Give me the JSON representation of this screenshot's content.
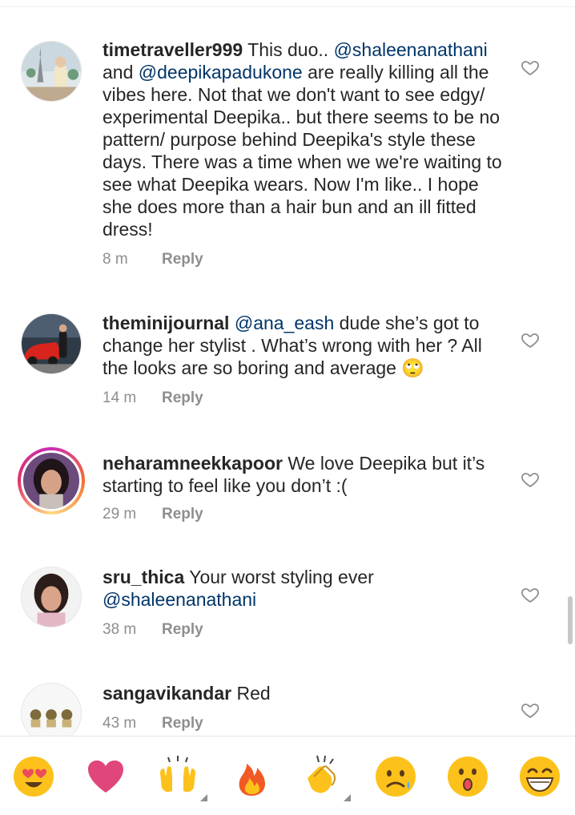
{
  "comments": [
    {
      "username": "timetraveller999",
      "parts": [
        {
          "t": " This duo.. "
        },
        {
          "t": "@shaleenanathani",
          "m": true
        },
        {
          "t": " and "
        },
        {
          "t": "@deepikapadukone",
          "m": true
        },
        {
          "t": " are really killing all the vibes here. Not that we don't want to see edgy/ experimental Deepika.. but there seems to be no pattern/ purpose behind Deepika's style these days. There was a time when we we're waiting to see what Deepika wears. Now I'm like.. I hope she does more than a hair bun and an ill fitted dress!"
        }
      ],
      "time": "8 m",
      "reply": "Reply"
    },
    {
      "username": "theminijournal",
      "parts": [
        {
          "t": " "
        },
        {
          "t": "@ana_eash",
          "m": true
        },
        {
          "t": "  dude she’s got to change her stylist . What’s wrong with her ? All the looks are so boring and average 🙄"
        }
      ],
      "time": "14 m",
      "reply": "Reply"
    },
    {
      "username": "neharamneekkapoor",
      "parts": [
        {
          "t": " We love Deepika but it’s starting to feel like you don’t :("
        }
      ],
      "time": "29 m",
      "reply": "Reply"
    },
    {
      "username": "sru_thica",
      "parts": [
        {
          "t": " Your worst styling ever "
        },
        {
          "t": "@shaleenanathani",
          "m": true
        }
      ],
      "time": "38 m",
      "reply": "Reply"
    },
    {
      "username": "sangavikandar",
      "parts": [
        {
          "t": " Red"
        }
      ],
      "time": "43 m",
      "reply": "Reply"
    }
  ],
  "emoji_bar": [
    {
      "icon": "heart-eyes-emoji",
      "glyph": "😍"
    },
    {
      "icon": "heart-emoji",
      "glyph": "❤️"
    },
    {
      "icon": "raised-hands-emoji",
      "glyph": "🙌"
    },
    {
      "icon": "fire-emoji",
      "glyph": "🔥"
    },
    {
      "icon": "clapping-hands-emoji",
      "glyph": "👏"
    },
    {
      "icon": "sad-face-emoji",
      "glyph": "😢"
    },
    {
      "icon": "surprised-face-emoji",
      "glyph": "😮"
    },
    {
      "icon": "laughing-emoji",
      "glyph": "😂"
    }
  ],
  "colors": {
    "text": "#262626",
    "mention": "#003569",
    "meta": "#8e8e8e",
    "emoji_yellow": "#fcc21b",
    "heart_pink": "#e0457b"
  }
}
